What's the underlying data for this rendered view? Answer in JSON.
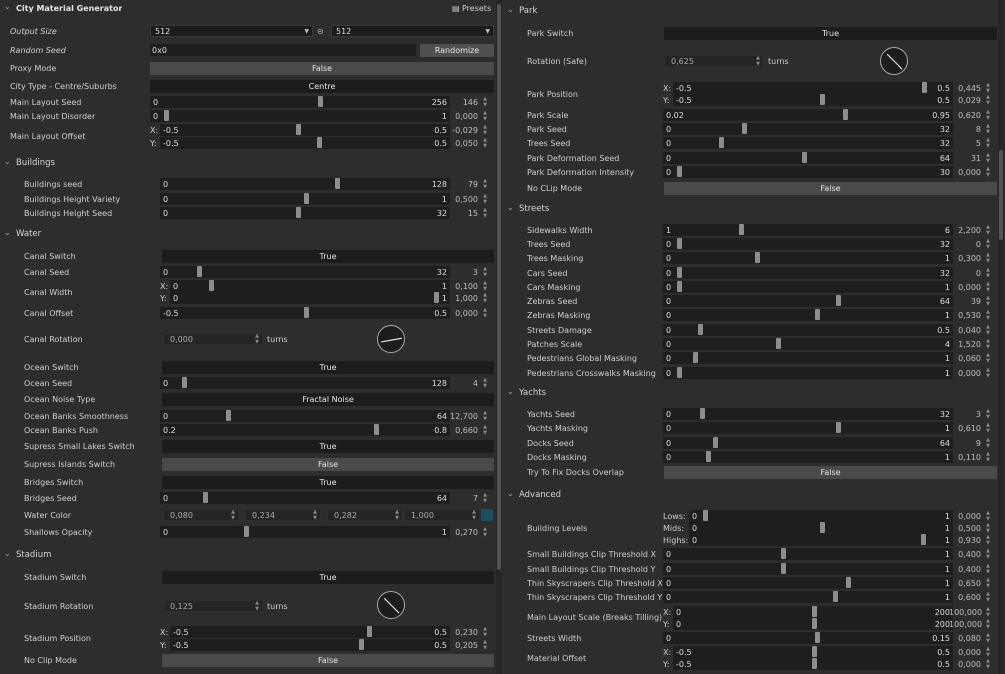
{
  "presets_label": "Presets",
  "unit_turns": "turns",
  "left": {
    "title": "City Material Generator",
    "output_size": {
      "label": "Output Size",
      "w": "512",
      "h": "512"
    },
    "random_seed": {
      "label": "Random Seed",
      "value": "0x0",
      "button": "Randomize"
    },
    "proxy_mode": {
      "label": "Proxy Mode",
      "value": "False"
    },
    "city_type": {
      "label": "City Type - Centre/Suburbs",
      "value": "Centre"
    },
    "main_layout_seed": {
      "label": "Main Layout Seed",
      "min": "0",
      "max": "256",
      "value": "146",
      "level": 0.57
    },
    "main_layout_disorder": {
      "label": "Main Layout Disorder",
      "min": "0",
      "max": "1",
      "value": "0,000",
      "level": 0.0
    },
    "main_layout_offset": {
      "label": "Main Layout Offset",
      "x": {
        "axis": "X:",
        "min": "-0.5",
        "max": "0.5",
        "value": "-0,029",
        "level": 0.47
      },
      "y": {
        "axis": "Y:",
        "min": "-0.5",
        "max": "0.5",
        "value": "0,050",
        "level": 0.55
      }
    },
    "buildings": {
      "title": "Buildings",
      "seed": {
        "label": "Buildings seed",
        "min": "0",
        "max": "128",
        "value": "79",
        "level": 0.62
      },
      "height_variety": {
        "label": "Buildings Height Variety",
        "min": "0",
        "max": "1",
        "value": "0,500",
        "level": 0.5
      },
      "height_seed": {
        "label": "Buildings Height Seed",
        "min": "0",
        "max": "32",
        "value": "15",
        "level": 0.47
      }
    },
    "water": {
      "title": "Water",
      "canal_switch": {
        "label": "Canal Switch",
        "value": "True"
      },
      "canal_seed": {
        "label": "Canal Seed",
        "min": "0",
        "max": "32",
        "value": "3",
        "level": 0.09
      },
      "canal_width": {
        "label": "Canal Width",
        "x": {
          "axis": "X:",
          "min": "0",
          "max": "1",
          "value": "0,100",
          "level": 0.1
        },
        "y": {
          "axis": "Y:",
          "min": "0",
          "max": "1",
          "value": "1,000",
          "level": 1.0
        }
      },
      "canal_offset": {
        "label": "Canal Offset",
        "min": "-0.5",
        "max": "0.5",
        "value": "0,000",
        "level": 0.5
      },
      "canal_rotation": {
        "label": "Canal Rotation",
        "value": "0,000"
      },
      "ocean_switch": {
        "label": "Ocean Switch",
        "value": "True"
      },
      "ocean_seed": {
        "label": "Ocean Seed",
        "min": "0",
        "max": "128",
        "value": "4",
        "level": 0.03
      },
      "ocean_noise_type": {
        "label": "Ocean Noise Type",
        "value": "Fractal Noise"
      },
      "ocean_banks_smoothness": {
        "label": "Ocean Banks Smoothness",
        "min": "0",
        "max": "64",
        "value": "12,700",
        "level": 0.2
      },
      "ocean_banks_push": {
        "label": "Ocean Banks Push",
        "min": "0.2",
        "max": "0.8",
        "value": "0,660",
        "level": 0.77
      },
      "supress_small_lakes": {
        "label": "Supress Small Lakes Switch",
        "value": "True"
      },
      "supress_islands": {
        "label": "Supress Islands Switch",
        "value": "False"
      },
      "bridges_switch": {
        "label": "Bridges Switch",
        "value": "True"
      },
      "bridges_seed": {
        "label": "Bridges Seed",
        "min": "0",
        "max": "64",
        "value": "7",
        "level": 0.11
      },
      "water_color": {
        "label": "Water Color",
        "r": "0,080",
        "g": "0,234",
        "b": "0,282",
        "a": "1,000",
        "swatch": "#1b4e5e"
      },
      "shallows_opacity": {
        "label": "Shallows Opacity",
        "min": "0",
        "max": "1",
        "value": "0,270",
        "level": 0.27
      }
    },
    "stadium": {
      "title": "Stadium",
      "switch": {
        "label": "Stadium Switch",
        "value": "True"
      },
      "rotation": {
        "label": "Stadium Rotation",
        "value": "0,125"
      },
      "position": {
        "label": "Stadium Position",
        "x": {
          "axis": "X:",
          "min": "-0.5",
          "max": "0.5",
          "value": "0,230",
          "level": 0.73
        },
        "y": {
          "axis": "Y:",
          "min": "-0.5",
          "max": "0.5",
          "value": "0,205",
          "level": 0.7
        }
      },
      "no_clip": {
        "label": "No Clip Mode",
        "value": "False"
      }
    }
  },
  "right": {
    "park": {
      "title": "Park",
      "switch": {
        "label": "Park Switch",
        "value": "True"
      },
      "rotation": {
        "label": "Rotation (Safe)",
        "value": "0,625"
      },
      "position": {
        "label": "Park Position",
        "x": {
          "axis": "X:",
          "min": "-0.5",
          "max": "0.5",
          "value": "0,445",
          "level": 0.94
        },
        "y": {
          "axis": "Y:",
          "min": "-0.5",
          "max": "0.5",
          "value": "0,029",
          "level": 0.53
        }
      },
      "scale": {
        "label": "Park Scale",
        "min": "0.02",
        "max": "0.95",
        "value": "0,620",
        "level": 0.64
      },
      "seed": {
        "label": "Park Seed",
        "min": "0",
        "max": "32",
        "value": "8",
        "level": 0.25
      },
      "trees_seed": {
        "label": "Trees Seed",
        "min": "0",
        "max": "32",
        "value": "5",
        "level": 0.16
      },
      "deformation_seed": {
        "label": "Park Deformation Seed",
        "min": "0",
        "max": "64",
        "value": "31",
        "level": 0.48
      },
      "deformation_intensity": {
        "label": "Park Deformation Intensity",
        "min": "0",
        "max": "30",
        "value": "0,000",
        "level": 0.0
      },
      "no_clip": {
        "label": "No CLip Mode",
        "value": "False"
      }
    },
    "streets": {
      "title": "Streets",
      "sidewalks_width": {
        "label": "Sidewalks Width",
        "min": "1",
        "max": "6",
        "value": "2,200",
        "level": 0.24
      },
      "trees_seed": {
        "label": "Trees Seed",
        "min": "0",
        "max": "32",
        "value": "0",
        "level": 0.0
      },
      "trees_masking": {
        "label": "Trees Masking",
        "min": "0",
        "max": "1",
        "value": "0,300",
        "level": 0.3
      },
      "cars_seed": {
        "label": "Cars Seed",
        "min": "0",
        "max": "32",
        "value": "0",
        "level": 0.0
      },
      "cars_masking": {
        "label": "Cars Masking",
        "min": "0",
        "max": "1",
        "value": "0,000",
        "level": 0.0
      },
      "zebras_seed": {
        "label": "Zebras Seed",
        "min": "0",
        "max": "64",
        "value": "39",
        "level": 0.61
      },
      "zebras_masking": {
        "label": "Zebras Masking",
        "min": "0",
        "max": "1",
        "value": "0,530",
        "level": 0.53
      },
      "streets_damage": {
        "label": "Streets Damage",
        "min": "0",
        "max": "0.5",
        "value": "0,040",
        "level": 0.08
      },
      "patches_scale": {
        "label": "Patches Scale",
        "min": "0",
        "max": "4",
        "value": "1,520",
        "level": 0.38
      },
      "ped_global_masking": {
        "label": "Pedestrians Global Masking",
        "min": "0",
        "max": "1",
        "value": "0,060",
        "level": 0.06
      },
      "ped_crosswalks_masking": {
        "label": "Pedestrians Crosswalks Masking",
        "min": "0",
        "max": "1",
        "value": "0,000",
        "level": 0.0
      }
    },
    "yachts": {
      "title": "Yachts",
      "seed": {
        "label": "Yachts Seed",
        "min": "0",
        "max": "32",
        "value": "3",
        "level": 0.09
      },
      "masking": {
        "label": "Yachts Masking",
        "min": "0",
        "max": "1",
        "value": "0,610",
        "level": 0.61
      },
      "docks_seed": {
        "label": "Docks Seed",
        "min": "0",
        "max": "64",
        "value": "9",
        "level": 0.14
      },
      "docks_masking": {
        "label": "Docks Masking",
        "min": "0",
        "max": "1",
        "value": "0,110",
        "level": 0.11
      },
      "fix_docks_overlap": {
        "label": "Try To Fix Docks Overlap",
        "value": "False"
      }
    },
    "advanced": {
      "title": "Advanced",
      "building_levels": {
        "label": "Building Levels",
        "lows": {
          "axis": "Lows:",
          "min": "0",
          "max": "1",
          "value": "0,000",
          "level": 0.0
        },
        "mids": {
          "axis": "Mids:",
          "min": "0",
          "max": "1",
          "value": "0,500",
          "level": 0.5
        },
        "highs": {
          "axis": "Highs:",
          "min": "0",
          "max": "1",
          "value": "0,930",
          "level": 0.93
        }
      },
      "small_clip_x": {
        "label": "Small Buildings Clip Threshold X",
        "min": "0",
        "max": "1",
        "value": "0,400",
        "level": 0.4
      },
      "small_clip_y": {
        "label": "Small Buildings Clip Threshold Y",
        "min": "0",
        "max": "1",
        "value": "0,400",
        "level": 0.4
      },
      "thin_clip_x": {
        "label": "Thin Skyscrapers Clip Threshold X",
        "min": "0",
        "max": "1",
        "value": "0,650",
        "level": 0.65
      },
      "thin_clip_y": {
        "label": "Thin Skyscrapers Clip Threshold Y",
        "min": "0",
        "max": "1",
        "value": "0,600",
        "level": 0.6
      },
      "main_layout_scale": {
        "label": "Main Layout Scale (Breaks Tilling)",
        "x": {
          "axis": "X:",
          "min": "0",
          "max": "200",
          "value": "100,000",
          "level": 0.5
        },
        "y": {
          "axis": "Y:",
          "min": "0",
          "max": "200",
          "value": "100,000",
          "level": 0.5
        }
      },
      "streets_width": {
        "label": "Streets Width",
        "min": "0",
        "max": "0.15",
        "value": "0,080",
        "level": 0.53
      },
      "material_offset": {
        "label": "Material Offset",
        "x": {
          "axis": "X:",
          "min": "-0.5",
          "max": "0.5",
          "value": "0,000",
          "level": 0.5
        },
        "y": {
          "axis": "Y:",
          "min": "-0.5",
          "max": "0.5",
          "value": "0,000",
          "level": 0.5
        }
      }
    }
  }
}
